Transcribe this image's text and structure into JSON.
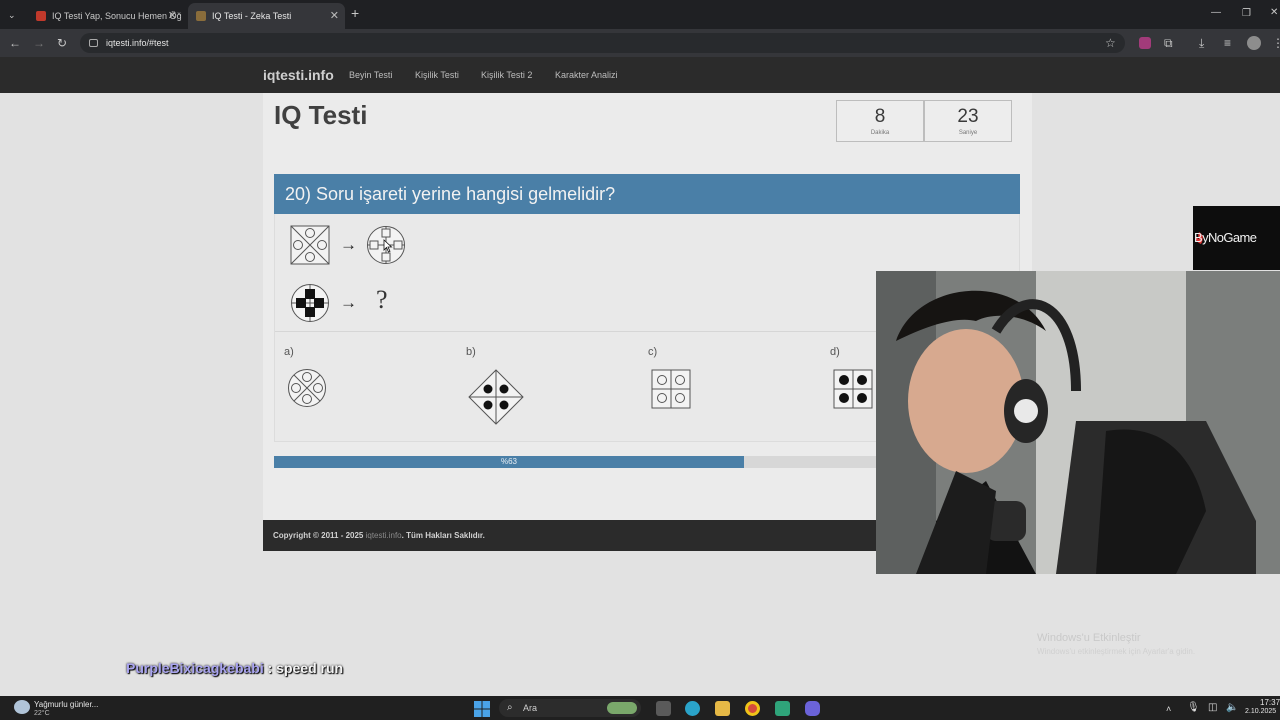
{
  "browser": {
    "tabs": [
      {
        "title": "IQ Testi Yap, Sonucu Hemen Öğ",
        "active": false
      },
      {
        "title": "IQ Testi - Zeka Testi",
        "active": true
      }
    ],
    "new_tab_symbol": "+",
    "url": "iqtesti.info/#test"
  },
  "site": {
    "brand": "iqtesti.info",
    "nav": [
      "Beyin Testi",
      "Kişilik Testi",
      "Kişilik Testi 2",
      "Karakter Analizi"
    ]
  },
  "page": {
    "title": "IQ Testi",
    "timer": {
      "minutes": "8",
      "minutes_unit": "Dakika",
      "seconds": "23",
      "seconds_unit": "Saniye"
    },
    "question": "20) Soru işareti yerine hangisi gelmelidir?",
    "question_mark": "?",
    "arrow_symbol": "→",
    "options": [
      "a)",
      "b)",
      "c)",
      "d)"
    ],
    "progress": {
      "percent": 63,
      "label": "%63"
    },
    "footer": {
      "copyright": "Copyright © 2011 - 2025",
      "site": "iqtesti.info",
      "rights": ". Tüm Hakları Saklıdır."
    }
  },
  "overlay": {
    "logo_text": "ByNoGame",
    "chat_user": "PurpleBixicagkebabi",
    "chat_separator": " : ",
    "chat_message": "speed run",
    "watermark_line1": "Windows'u Etkinleştir",
    "watermark_line2": "Windows'u etkinleştirmek için Ayarlar'a gidin."
  },
  "taskbar": {
    "weather_title": "Yağmurlu günler...",
    "weather_temp": "22°C",
    "search_placeholder": "Ara",
    "time": "17:37",
    "date": "2.10.2025"
  },
  "colors": {
    "accent_blue": "#4a7fa7",
    "site_nav_bg": "#2b2b2b",
    "browser_bg": "#35363a",
    "page_bg": "#e2e2e2"
  },
  "icons": [
    "menu-chevron-icon",
    "back-arrow-icon",
    "forward-arrow-icon",
    "reload-icon",
    "star-icon",
    "extensions-icon",
    "download-icon",
    "profile-icon",
    "windows-start-icon",
    "search-icon",
    "edge-icon",
    "folder-icon",
    "chrome-icon",
    "wifi-icon",
    "volume-icon"
  ]
}
